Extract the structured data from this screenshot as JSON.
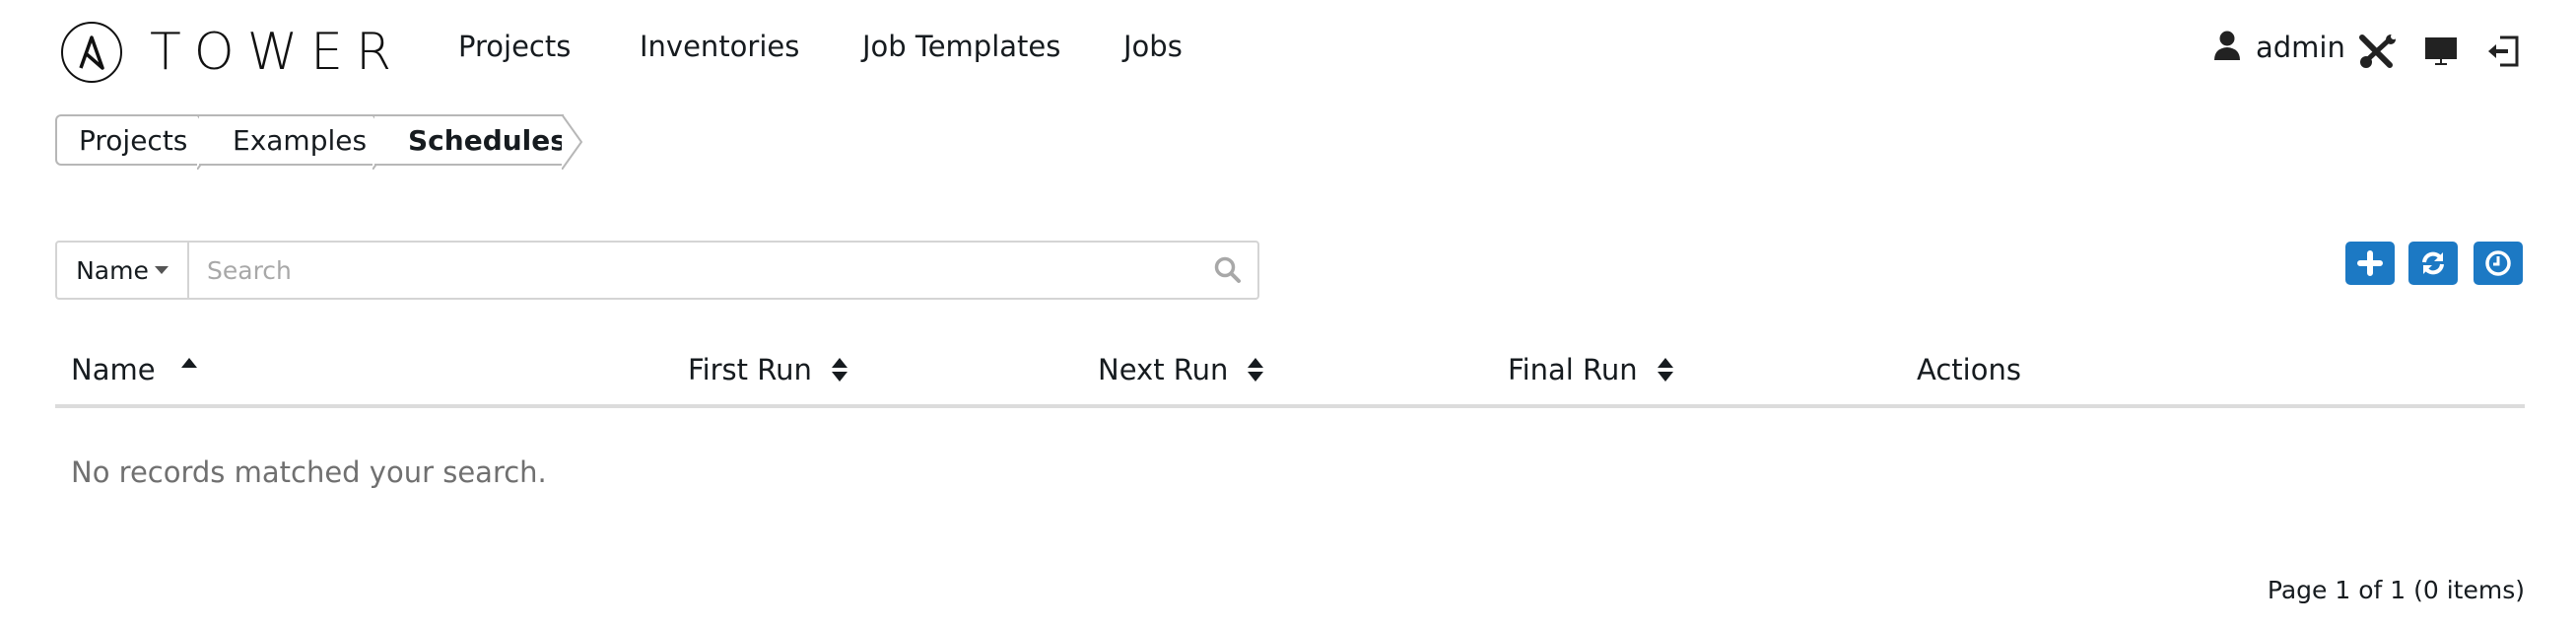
{
  "app": {
    "logo_text": "TOWER"
  },
  "nav": {
    "items": [
      {
        "label": "Projects"
      },
      {
        "label": "Inventories"
      },
      {
        "label": "Job Templates"
      },
      {
        "label": "Jobs"
      }
    ]
  },
  "user": {
    "name": "admin",
    "icons": [
      "user-icon",
      "wrench-screwdriver-icon",
      "monitor-icon",
      "logout-icon"
    ]
  },
  "breadcrumb": [
    {
      "label": "Projects"
    },
    {
      "label": "Examples"
    },
    {
      "label": "Schedules"
    }
  ],
  "search": {
    "key_label": "Name",
    "placeholder": "Search",
    "value": ""
  },
  "actions": {
    "add": "add-icon",
    "refresh": "refresh-icon",
    "history": "clock-icon",
    "accent": "#1c79c4"
  },
  "table": {
    "columns": [
      {
        "label": "Name",
        "sort": "ascending"
      },
      {
        "label": "First Run",
        "sort": "both"
      },
      {
        "label": "Next Run",
        "sort": "both"
      },
      {
        "label": "Final Run",
        "sort": "both"
      },
      {
        "label": "Actions",
        "sort": "none"
      }
    ],
    "empty_message": "No records matched your search."
  },
  "pagination": {
    "text": "Page 1 of 1 (0 items)"
  }
}
